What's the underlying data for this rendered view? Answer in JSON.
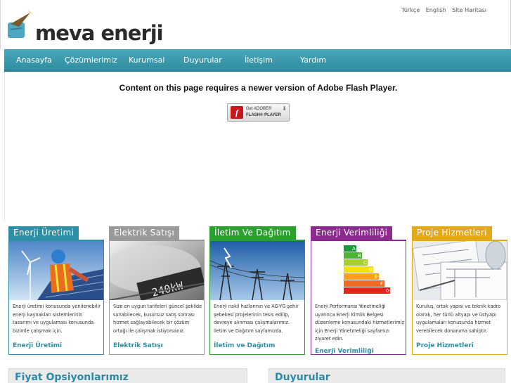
{
  "header": {
    "logo_text": "meva enerji",
    "top_links": [
      "Türkçe",
      "English",
      "Site Haritası"
    ]
  },
  "nav": {
    "items": [
      "Anasayfa",
      "Çözümlerimiz",
      "Kurumsal",
      "Duyurular",
      "İletişim",
      "Yardım"
    ]
  },
  "flash": {
    "message": "Content on this page requires a newer version of Adobe Flash Player.",
    "button_line1": "Get ADOBE®",
    "button_line2": "FLASH® PLAYER"
  },
  "cards": [
    {
      "title": "Enerji Üretimi",
      "color": "#2d8fa6",
      "text": "Enerji üretimi konusunda yenilenebilir enerji kaynakları sistemlerinin tasarımı ve uygulaması konusunda bizimle çalışmak için.",
      "link": "Enerji Üretimi"
    },
    {
      "title": "Elektrik Satışı",
      "color": "#9a9a9a",
      "text": "Size en uygun tarifeleri güncel şekilde sunabilecek, kusursuz satış sonrası hizmet sağlayabilecek bir çözüm ortağı ile çalışmak istiyorsanız.",
      "link": "Elektrik Satışı"
    },
    {
      "title": "İletim Ve Dağıtım",
      "color": "#2aa02e",
      "text": "Enerji nakil hatlarının ve AG-YG şehir şebekesi projelerinin tesis edilip, devreye alınması çalışmalarımız. İletim ve Dağıtım sayfamızda.",
      "link": "İletim ve Dağıtım"
    },
    {
      "title": "Enerji Verimliliği",
      "color": "#8b2a8f",
      "text": "Enerji Performansı Yönetmeliği uyarınca Enerji Kimlik Belgesi düzenleme konusundaki hizmetlerimiz için Enerji Yönetmeliği sayfamızı ziyaret edin.",
      "link": "Enerji Verimliliği"
    },
    {
      "title": "Proje Hizmetleri",
      "color": "#e5a818",
      "text": "Kuruluş, ortak yapısı ve teknik kadro olarak, her türlü altyapı ve üstyapı uygulamaları konusunda hizmet verebilecek donanıma sahiptir.",
      "link": "Proje Hizmetleri"
    }
  ],
  "bottom": {
    "price_title": "Fiyat Opsiyonlarımız",
    "news_title": "Duyurular"
  }
}
